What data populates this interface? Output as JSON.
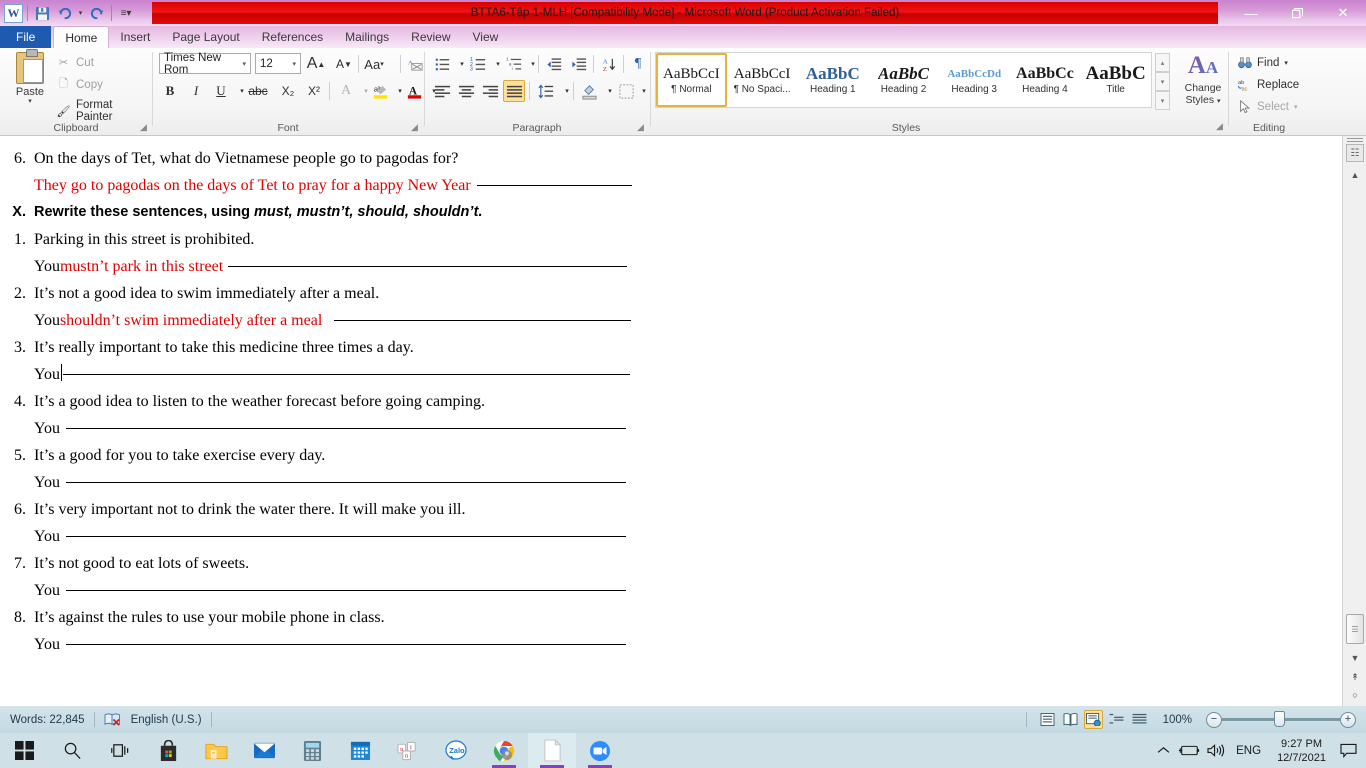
{
  "window": {
    "title": "BTTA6-Tập 1-MLH [Compatibility Mode]  -  Microsoft Word (Product Activation Failed)",
    "app_logo": "W",
    "minimize": "—",
    "restore": "❐",
    "close": "✕",
    "help": "?",
    "collapse_ribbon": "⌃"
  },
  "quick_access": [
    {
      "name": "save-icon",
      "glyph": "💾"
    },
    {
      "name": "undo-icon",
      "glyph": "↶"
    },
    {
      "name": "undo-dropdown-icon",
      "glyph": "▾"
    },
    {
      "name": "redo-icon",
      "glyph": "↻"
    },
    {
      "name": "customize-qat-icon",
      "glyph": "☰"
    }
  ],
  "tabs": [
    {
      "label": "File",
      "active": false,
      "file": true
    },
    {
      "label": "Home",
      "active": true
    },
    {
      "label": "Insert",
      "active": false
    },
    {
      "label": "Page Layout",
      "active": false
    },
    {
      "label": "References",
      "active": false
    },
    {
      "label": "Mailings",
      "active": false
    },
    {
      "label": "Review",
      "active": false
    },
    {
      "label": "View",
      "active": false
    }
  ],
  "ribbon": {
    "clipboard": {
      "group_label": "Clipboard",
      "paste_label": "Paste",
      "paste_arrow": "▾",
      "cut_label": "Cut",
      "copy_label": "Copy",
      "format_painter_label": "Format Painter",
      "dialog_launcher": "⤵"
    },
    "font": {
      "group_label": "Font",
      "font_name": "Times New Rom",
      "font_size": "12",
      "caret": "▾",
      "grow_font": "A",
      "shrink_font": "A",
      "change_case": "Aa",
      "clear_formatting": "✐",
      "bold": "B",
      "italic": "I",
      "underline": "U",
      "strikethrough": "abc",
      "subscript": "X₂",
      "superscript": "X²",
      "text_effects": "A",
      "highlight": "ab",
      "font_color": "A",
      "dialog_launcher": "⤵"
    },
    "paragraph": {
      "group_label": "Paragraph",
      "bullets": "☰",
      "numbering": "☰",
      "multilevel": "☰",
      "decrease_indent": "⇤",
      "increase_indent": "⇥",
      "sort": "A↓",
      "show_marks": "¶",
      "align_left": "≡",
      "align_center": "≡",
      "align_right": "≡",
      "justify": "≡",
      "line_spacing": "↕",
      "shading": "▤",
      "borders": "▦",
      "dialog_launcher": "⤵"
    },
    "styles": {
      "group_label": "Styles",
      "items": [
        {
          "preview": "AaBbCcI",
          "name": "¶ Normal",
          "selected": true
        },
        {
          "preview": "AaBbCcI",
          "name": "¶ No Spaci...",
          "selected": false
        },
        {
          "preview": "AaBbC",
          "name": "Heading 1",
          "selected": false
        },
        {
          "preview": "AaBbC",
          "name": "Heading 2",
          "selected": false
        },
        {
          "preview": "AaBbCcDd",
          "name": "Heading 3",
          "selected": false
        },
        {
          "preview": "AaBbCc",
          "name": "Heading 4",
          "selected": false
        },
        {
          "preview": "AaBbC",
          "name": "Title",
          "selected": false
        }
      ],
      "scroll_up": "▴",
      "scroll_down": "▾",
      "more": "▾",
      "dialog_launcher": "⤵"
    },
    "change_styles": {
      "label_line1": "Change",
      "label_line2": "Styles",
      "caret": "▾",
      "glyph": "A"
    },
    "editing": {
      "group_label": "Editing",
      "find_label": "Find",
      "find_caret": "▾",
      "replace_label": "Replace",
      "select_label": "Select",
      "select_caret": "▾"
    }
  },
  "document": {
    "lines": [
      {
        "type": "numbered",
        "num": "6.",
        "text": "On the days of Tet, what do Vietnamese people go to pagodas for?",
        "color": "black",
        "bold": false
      },
      {
        "type": "answer",
        "prefix": "",
        "answer": "They go to pagodas on the days of Tet to pray for a happy New Year",
        "answer_color": "red",
        "rule_width": 155
      },
      {
        "type": "heading",
        "num": "X.",
        "text_plain": "Rewrite these sentences, using ",
        "text_italic": "must, mustn’t, should, shouldn’t."
      },
      {
        "type": "numbered",
        "num": "1.",
        "text": "Parking in this street is prohibited.",
        "color": "black",
        "bold": false
      },
      {
        "type": "answer",
        "prefix": "You ",
        "answer": "mustn’t park in this street",
        "answer_color": "red",
        "rule_width": 399
      },
      {
        "type": "numbered",
        "num": "2.",
        "text": "It’s not a good idea to swim immediately after a meal.",
        "color": "black",
        "bold": false
      },
      {
        "type": "answer",
        "prefix": "You ",
        "answer": "shouldn’t swim immediately after a meal",
        "answer_color": "red",
        "rule_width": 297
      },
      {
        "type": "numbered",
        "num": "3.",
        "text": "It’s really important to take this medicine three times a day.",
        "color": "black",
        "bold": false
      },
      {
        "type": "answer",
        "prefix": "You",
        "answer": "",
        "cursor": true,
        "rule_width": 567
      },
      {
        "type": "numbered",
        "num": "4.",
        "text": "It’s a good idea to listen to the weather forecast before going camping.",
        "color": "black",
        "bold": false
      },
      {
        "type": "answer",
        "prefix": "You ",
        "answer": "",
        "rule_width": 560
      },
      {
        "type": "numbered",
        "num": "5.",
        "text": "It’s a good for you to take exercise every day.",
        "color": "black",
        "bold": false
      },
      {
        "type": "answer",
        "prefix": "You ",
        "answer": "",
        "rule_width": 560
      },
      {
        "type": "numbered",
        "num": "6.",
        "text": "It’s very important not to drink the water there. It will make you ill.",
        "color": "black",
        "bold": false
      },
      {
        "type": "answer",
        "prefix": "You ",
        "answer": "",
        "rule_width": 560
      },
      {
        "type": "numbered",
        "num": "7.",
        "text": "It’s not good to eat lots of sweets.",
        "color": "black",
        "bold": false
      },
      {
        "type": "answer",
        "prefix": "You ",
        "answer": "",
        "rule_width": 560
      },
      {
        "type": "numbered",
        "num": "8.",
        "text": "It’s against the rules to use your mobile phone in class.",
        "color": "black",
        "bold": false
      },
      {
        "type": "answer",
        "prefix": "You ",
        "answer": "",
        "rule_width": 560
      }
    ]
  },
  "status_bar": {
    "word_count": "Words: 22,845",
    "language": "English (U.S.)",
    "zoom_level": "100%",
    "zoom_out": "−",
    "zoom_in": "+",
    "views": [
      {
        "name": "print-layout-view",
        "glyph": "▤",
        "selected": false
      },
      {
        "name": "full-screen-reading-view",
        "glyph": "▧",
        "selected": false
      },
      {
        "name": "web-layout-view",
        "glyph": "▥",
        "selected": true
      },
      {
        "name": "outline-view",
        "glyph": "≣",
        "selected": false
      },
      {
        "name": "draft-view",
        "glyph": "≡",
        "selected": false
      }
    ]
  },
  "taskbar": {
    "items": [
      {
        "name": "start-button",
        "label": "Start"
      },
      {
        "name": "search-icon",
        "label": "Search"
      },
      {
        "name": "task-view-icon",
        "label": "Task View"
      },
      {
        "name": "microsoft-store-icon",
        "label": "Microsoft Store"
      },
      {
        "name": "file-explorer-icon",
        "label": "File Explorer"
      },
      {
        "name": "mail-icon",
        "label": "Mail"
      },
      {
        "name": "calculator-icon",
        "label": "Calculator"
      },
      {
        "name": "calendar-icon",
        "label": "Calendar"
      },
      {
        "name": "unikey-icon",
        "label": "Unikey"
      },
      {
        "name": "zalo-icon",
        "label": "Zalo"
      },
      {
        "name": "chrome-icon",
        "label": "Google Chrome"
      },
      {
        "name": "word-icon",
        "label": "Microsoft Word"
      },
      {
        "name": "zoom-meeting-icon",
        "label": "Zoom"
      }
    ],
    "tray": {
      "show_hidden": "⌃",
      "battery": "▭",
      "volume": "◂",
      "language": "ENG",
      "time": "9:27 PM",
      "date": "12/7/2021",
      "notifications": "▭"
    }
  },
  "colors": {
    "title_red": "#e20b0b",
    "title_purple": "#d79bd8",
    "file_tab_blue": "#1e5bb0",
    "answer_red": "#e00000",
    "highlight_gold": "#e3b33c",
    "taskbar_blue": "#cfe0e6"
  }
}
